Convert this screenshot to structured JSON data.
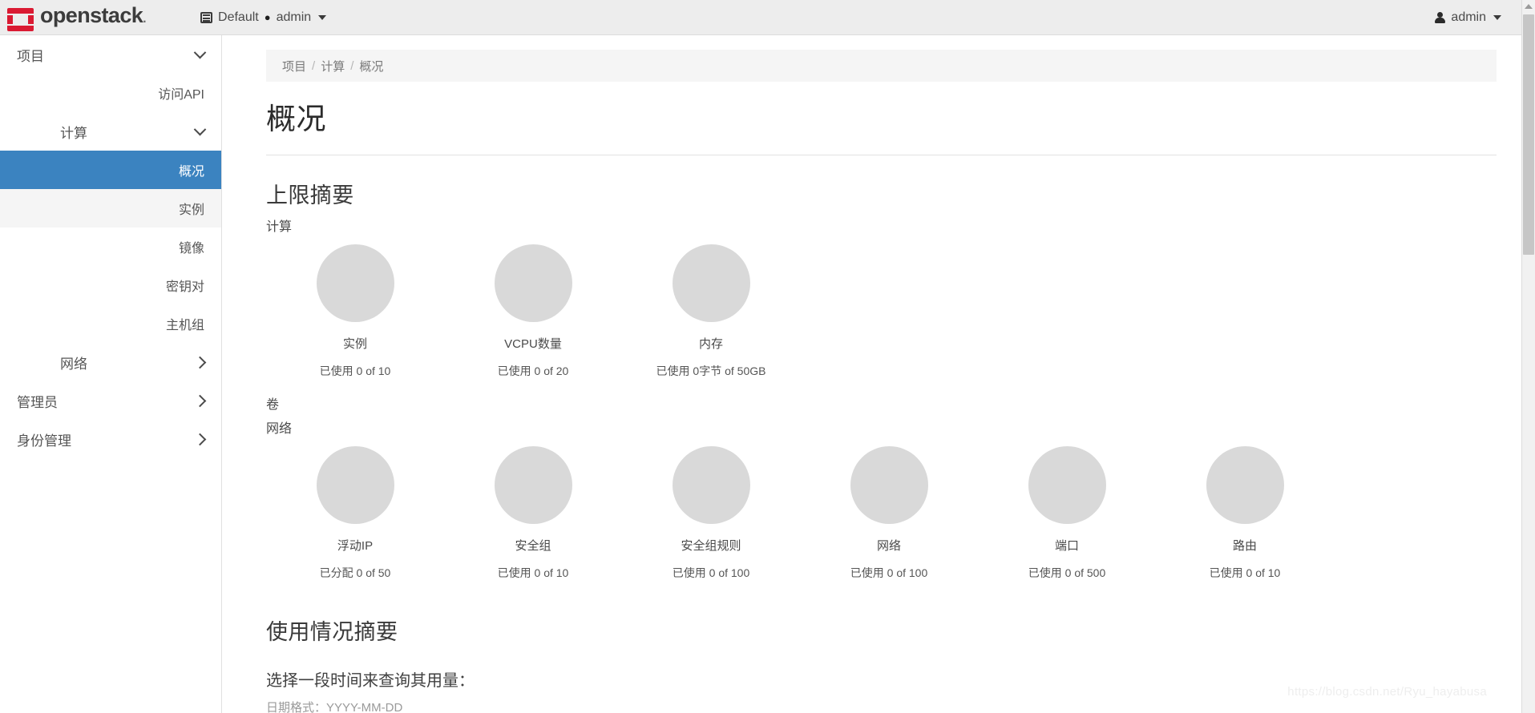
{
  "topbar": {
    "logo_text": "openstack",
    "logo_trademark": ".",
    "logo_icon": "openstack-logo-icon",
    "context_grid_icon": "grid-list-icon",
    "context_domain": "Default",
    "context_separator": "●",
    "context_project": "admin",
    "context_caret_icon": "caret-down-icon",
    "user_icon": "user-avatar-icon",
    "user_name": "admin",
    "user_caret_icon": "caret-down-icon"
  },
  "sidebar": {
    "items": [
      {
        "label": "项目",
        "level": "group",
        "icon": "chevron-down-icon",
        "active": false,
        "hovered": false
      },
      {
        "label": "访问API",
        "level": "leaf",
        "icon": "",
        "active": false,
        "hovered": false
      },
      {
        "label": "计算",
        "level": "sub-group",
        "icon": "chevron-down-icon",
        "active": false,
        "hovered": false
      },
      {
        "label": "概况",
        "level": "leaf",
        "icon": "",
        "active": true,
        "hovered": false
      },
      {
        "label": "实例",
        "level": "leaf",
        "icon": "",
        "active": false,
        "hovered": true
      },
      {
        "label": "镜像",
        "level": "leaf",
        "icon": "",
        "active": false,
        "hovered": false
      },
      {
        "label": "密钥对",
        "level": "leaf",
        "icon": "",
        "active": false,
        "hovered": false
      },
      {
        "label": "主机组",
        "level": "leaf",
        "icon": "",
        "active": false,
        "hovered": false
      },
      {
        "label": "网络",
        "level": "sub-group",
        "icon": "chevron-right-icon",
        "active": false,
        "hovered": false
      },
      {
        "label": "管理员",
        "level": "group",
        "icon": "chevron-right-icon",
        "active": false,
        "hovered": false
      },
      {
        "label": "身份管理",
        "level": "group",
        "icon": "chevron-right-icon",
        "active": false,
        "hovered": false
      }
    ]
  },
  "breadcrumb": {
    "items": [
      "项目",
      "计算",
      "概况"
    ],
    "separator": "/"
  },
  "page": {
    "title": "概况"
  },
  "quota_summary": {
    "heading": "上限摘要",
    "groups": [
      {
        "name": "计算",
        "items": [
          {
            "label": "实例",
            "usage": "已使用 0 of 10",
            "used": 0,
            "limit": 10,
            "percent": 0
          },
          {
            "label": "VCPU数量",
            "usage": "已使用 0 of 20",
            "used": 0,
            "limit": 20,
            "percent": 0
          },
          {
            "label": "内存",
            "usage": "已使用 0字节 of 50GB",
            "used": 0,
            "limit": 50,
            "percent": 0
          }
        ]
      },
      {
        "name": "卷",
        "items": []
      },
      {
        "name": "网络",
        "items": [
          {
            "label": "浮动IP",
            "usage": "已分配 0 of 50",
            "used": 0,
            "limit": 50,
            "percent": 0
          },
          {
            "label": "安全组",
            "usage": "已使用 0 of 10",
            "used": 0,
            "limit": 10,
            "percent": 0
          },
          {
            "label": "安全组规则",
            "usage": "已使用 0 of 100",
            "used": 0,
            "limit": 100,
            "percent": 0
          },
          {
            "label": "网络",
            "usage": "已使用 0 of 100",
            "used": 0,
            "limit": 100,
            "percent": 0
          },
          {
            "label": "端口",
            "usage": "已使用 0 of 500",
            "used": 0,
            "limit": 500,
            "percent": 0
          },
          {
            "label": "路由",
            "usage": "已使用 0 of 10",
            "used": 0,
            "limit": 10,
            "percent": 0
          }
        ]
      }
    ]
  },
  "usage_summary": {
    "heading": "使用情况摘要",
    "prompt": "选择一段时间来查询其用量：",
    "hint": "日期格式：YYYY-MM-DD"
  },
  "watermark": "https://blog.csdn.net/Ryu_hayabusa",
  "colors": {
    "accent_blue": "#3b83c0",
    "brand_red": "#da1a32",
    "topbar_bg": "#ededed",
    "donut_grey": "#d9d9d9",
    "breadcrumb_bg": "#f5f5f5"
  }
}
